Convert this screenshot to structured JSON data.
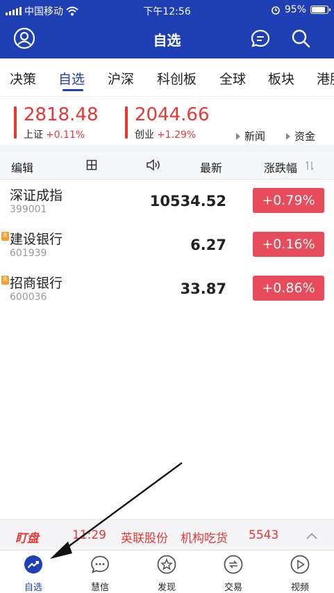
{
  "status_bar": {
    "carrier": "中国移动",
    "time": "下午12:56",
    "battery": "95%",
    "battery_level": 0.95
  },
  "header": {
    "title": "自选",
    "left_icon": "user-avatar-icon",
    "right_icons": [
      "message-icon",
      "search-icon"
    ]
  },
  "tabs": [
    {
      "label": "决策"
    },
    {
      "label": "自选",
      "active": true
    },
    {
      "label": "沪深"
    },
    {
      "label": "科创板"
    },
    {
      "label": "全球"
    },
    {
      "label": "板块"
    },
    {
      "label": "港股"
    }
  ],
  "indices": [
    {
      "value": "2818.48",
      "name": "上证",
      "change": "+0.11%"
    },
    {
      "value": "2044.66",
      "name": "创业",
      "change": "+1.29%"
    }
  ],
  "index_links": {
    "news": "新闻",
    "funds": "资金"
  },
  "columns": {
    "edit": "编辑",
    "latest": "最新",
    "change": "涨跌幅"
  },
  "stocks": [
    {
      "name": "深证成指",
      "code": "399001",
      "price": "10534.52",
      "change": "+0.79%",
      "badge": ""
    },
    {
      "name": "建设银行",
      "code": "601939",
      "price": "6.27",
      "change": "+0.16%",
      "badge": "R"
    },
    {
      "name": "招商银行",
      "code": "600036",
      "price": "33.87",
      "change": "+0.86%",
      "badge": "R"
    }
  ],
  "ticker": {
    "logo": "盯盘",
    "time": "11:29",
    "stock": "英联股份",
    "event": "机构吃货",
    "value": "5543"
  },
  "bottom_nav": [
    {
      "label": "自选",
      "icon": "trend-icon",
      "active": true
    },
    {
      "label": "慧信",
      "icon": "chat-icon"
    },
    {
      "label": "发现",
      "icon": "star-icon"
    },
    {
      "label": "交易",
      "icon": "exchange-icon"
    },
    {
      "label": "视频",
      "icon": "play-icon"
    }
  ],
  "colors": {
    "brand": "#1f3fb4",
    "up": "#e53935",
    "badge": "#e84b5b"
  }
}
